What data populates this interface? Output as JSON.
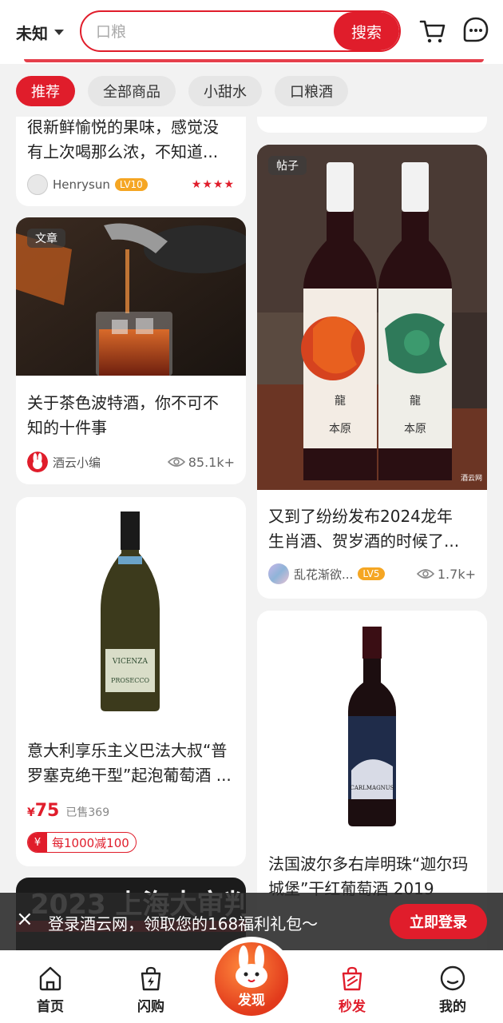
{
  "header": {
    "location": "未知",
    "search_placeholder": "口粮",
    "search_button": "搜索"
  },
  "tabs": [
    {
      "label": "推荐",
      "active": true
    },
    {
      "label": "全部商品",
      "active": false
    },
    {
      "label": "小甜水",
      "active": false
    },
    {
      "label": "口粮酒",
      "active": false
    }
  ],
  "feed": {
    "card_review": {
      "text": "很新鲜愉悦的果味，感觉没有上次喝那么浓，不知道...",
      "line1": "很新鲜愉悦的果味，感觉没",
      "line2": "有上次喝那么浓，不知道...",
      "author": "Henrysun",
      "level": "LV10",
      "stars": "★★★★"
    },
    "card_article": {
      "tag": "文章",
      "line1": "关于茶色波特酒，你不可不",
      "line2": "知的十件事",
      "author": "酒云小编",
      "views": "85.1k+"
    },
    "card_prosecco": {
      "line1": "意大利享乐主义巴法大叔“普",
      "line2": "罗塞克绝干型”起泡葡萄酒 ...",
      "yen": "¥",
      "price": "75",
      "sold": "已售369",
      "coupon_symbol": "¥",
      "coupon": "每1000减100",
      "bottle_brand": "VICENZA",
      "bottle_type": "PROSECCO"
    },
    "card_post": {
      "tag": "帖子",
      "line1": "又到了纷纷发布2024龙年",
      "line2": "生肖酒、贺岁酒的时候了...",
      "author": "乱花渐欲...",
      "level": "LV5",
      "views": "1.7k+",
      "label_char1": "龍",
      "label_char2": "本原",
      "watermark": "酒云网"
    },
    "card_chateau": {
      "line1": "法国波尔多右岸明珠“迦尔玛",
      "line2": "城堡”干红葡萄酒 2019",
      "bottle_label": "CARLMAGNUS"
    },
    "card_banner": {
      "text": "2023 上海大审判"
    }
  },
  "login_banner": {
    "close": "×",
    "text": "登录酒云网，领取您的168福利礼包～",
    "button": "立即登录"
  },
  "bottom_nav": {
    "home": "首页",
    "flash": "闪购",
    "discover": "发现",
    "seckill": "秒发",
    "mine": "我的"
  },
  "colors": {
    "brand_red": "#e01d2b",
    "level_orange": "#f5a623"
  }
}
